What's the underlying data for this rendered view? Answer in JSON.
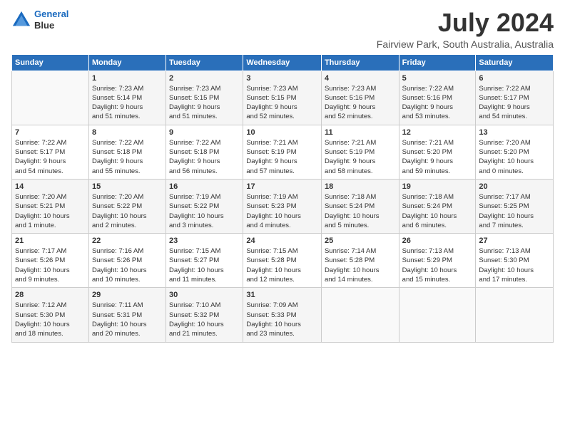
{
  "logo": {
    "line1": "General",
    "line2": "Blue"
  },
  "title": "July 2024",
  "subtitle": "Fairview Park, South Australia, Australia",
  "header_days": [
    "Sunday",
    "Monday",
    "Tuesday",
    "Wednesday",
    "Thursday",
    "Friday",
    "Saturday"
  ],
  "weeks": [
    [
      {
        "day": "",
        "info": ""
      },
      {
        "day": "1",
        "info": "Sunrise: 7:23 AM\nSunset: 5:14 PM\nDaylight: 9 hours\nand 51 minutes."
      },
      {
        "day": "2",
        "info": "Sunrise: 7:23 AM\nSunset: 5:15 PM\nDaylight: 9 hours\nand 51 minutes."
      },
      {
        "day": "3",
        "info": "Sunrise: 7:23 AM\nSunset: 5:15 PM\nDaylight: 9 hours\nand 52 minutes."
      },
      {
        "day": "4",
        "info": "Sunrise: 7:23 AM\nSunset: 5:16 PM\nDaylight: 9 hours\nand 52 minutes."
      },
      {
        "day": "5",
        "info": "Sunrise: 7:22 AM\nSunset: 5:16 PM\nDaylight: 9 hours\nand 53 minutes."
      },
      {
        "day": "6",
        "info": "Sunrise: 7:22 AM\nSunset: 5:17 PM\nDaylight: 9 hours\nand 54 minutes."
      }
    ],
    [
      {
        "day": "7",
        "info": "Sunrise: 7:22 AM\nSunset: 5:17 PM\nDaylight: 9 hours\nand 54 minutes."
      },
      {
        "day": "8",
        "info": "Sunrise: 7:22 AM\nSunset: 5:18 PM\nDaylight: 9 hours\nand 55 minutes."
      },
      {
        "day": "9",
        "info": "Sunrise: 7:22 AM\nSunset: 5:18 PM\nDaylight: 9 hours\nand 56 minutes."
      },
      {
        "day": "10",
        "info": "Sunrise: 7:21 AM\nSunset: 5:19 PM\nDaylight: 9 hours\nand 57 minutes."
      },
      {
        "day": "11",
        "info": "Sunrise: 7:21 AM\nSunset: 5:19 PM\nDaylight: 9 hours\nand 58 minutes."
      },
      {
        "day": "12",
        "info": "Sunrise: 7:21 AM\nSunset: 5:20 PM\nDaylight: 9 hours\nand 59 minutes."
      },
      {
        "day": "13",
        "info": "Sunrise: 7:20 AM\nSunset: 5:20 PM\nDaylight: 10 hours\nand 0 minutes."
      }
    ],
    [
      {
        "day": "14",
        "info": "Sunrise: 7:20 AM\nSunset: 5:21 PM\nDaylight: 10 hours\nand 1 minute."
      },
      {
        "day": "15",
        "info": "Sunrise: 7:20 AM\nSunset: 5:22 PM\nDaylight: 10 hours\nand 2 minutes."
      },
      {
        "day": "16",
        "info": "Sunrise: 7:19 AM\nSunset: 5:22 PM\nDaylight: 10 hours\nand 3 minutes."
      },
      {
        "day": "17",
        "info": "Sunrise: 7:19 AM\nSunset: 5:23 PM\nDaylight: 10 hours\nand 4 minutes."
      },
      {
        "day": "18",
        "info": "Sunrise: 7:18 AM\nSunset: 5:24 PM\nDaylight: 10 hours\nand 5 minutes."
      },
      {
        "day": "19",
        "info": "Sunrise: 7:18 AM\nSunset: 5:24 PM\nDaylight: 10 hours\nand 6 minutes."
      },
      {
        "day": "20",
        "info": "Sunrise: 7:17 AM\nSunset: 5:25 PM\nDaylight: 10 hours\nand 7 minutes."
      }
    ],
    [
      {
        "day": "21",
        "info": "Sunrise: 7:17 AM\nSunset: 5:26 PM\nDaylight: 10 hours\nand 9 minutes."
      },
      {
        "day": "22",
        "info": "Sunrise: 7:16 AM\nSunset: 5:26 PM\nDaylight: 10 hours\nand 10 minutes."
      },
      {
        "day": "23",
        "info": "Sunrise: 7:15 AM\nSunset: 5:27 PM\nDaylight: 10 hours\nand 11 minutes."
      },
      {
        "day": "24",
        "info": "Sunrise: 7:15 AM\nSunset: 5:28 PM\nDaylight: 10 hours\nand 12 minutes."
      },
      {
        "day": "25",
        "info": "Sunrise: 7:14 AM\nSunset: 5:28 PM\nDaylight: 10 hours\nand 14 minutes."
      },
      {
        "day": "26",
        "info": "Sunrise: 7:13 AM\nSunset: 5:29 PM\nDaylight: 10 hours\nand 15 minutes."
      },
      {
        "day": "27",
        "info": "Sunrise: 7:13 AM\nSunset: 5:30 PM\nDaylight: 10 hours\nand 17 minutes."
      }
    ],
    [
      {
        "day": "28",
        "info": "Sunrise: 7:12 AM\nSunset: 5:30 PM\nDaylight: 10 hours\nand 18 minutes."
      },
      {
        "day": "29",
        "info": "Sunrise: 7:11 AM\nSunset: 5:31 PM\nDaylight: 10 hours\nand 20 minutes."
      },
      {
        "day": "30",
        "info": "Sunrise: 7:10 AM\nSunset: 5:32 PM\nDaylight: 10 hours\nand 21 minutes."
      },
      {
        "day": "31",
        "info": "Sunrise: 7:09 AM\nSunset: 5:33 PM\nDaylight: 10 hours\nand 23 minutes."
      },
      {
        "day": "",
        "info": ""
      },
      {
        "day": "",
        "info": ""
      },
      {
        "day": "",
        "info": ""
      }
    ]
  ]
}
